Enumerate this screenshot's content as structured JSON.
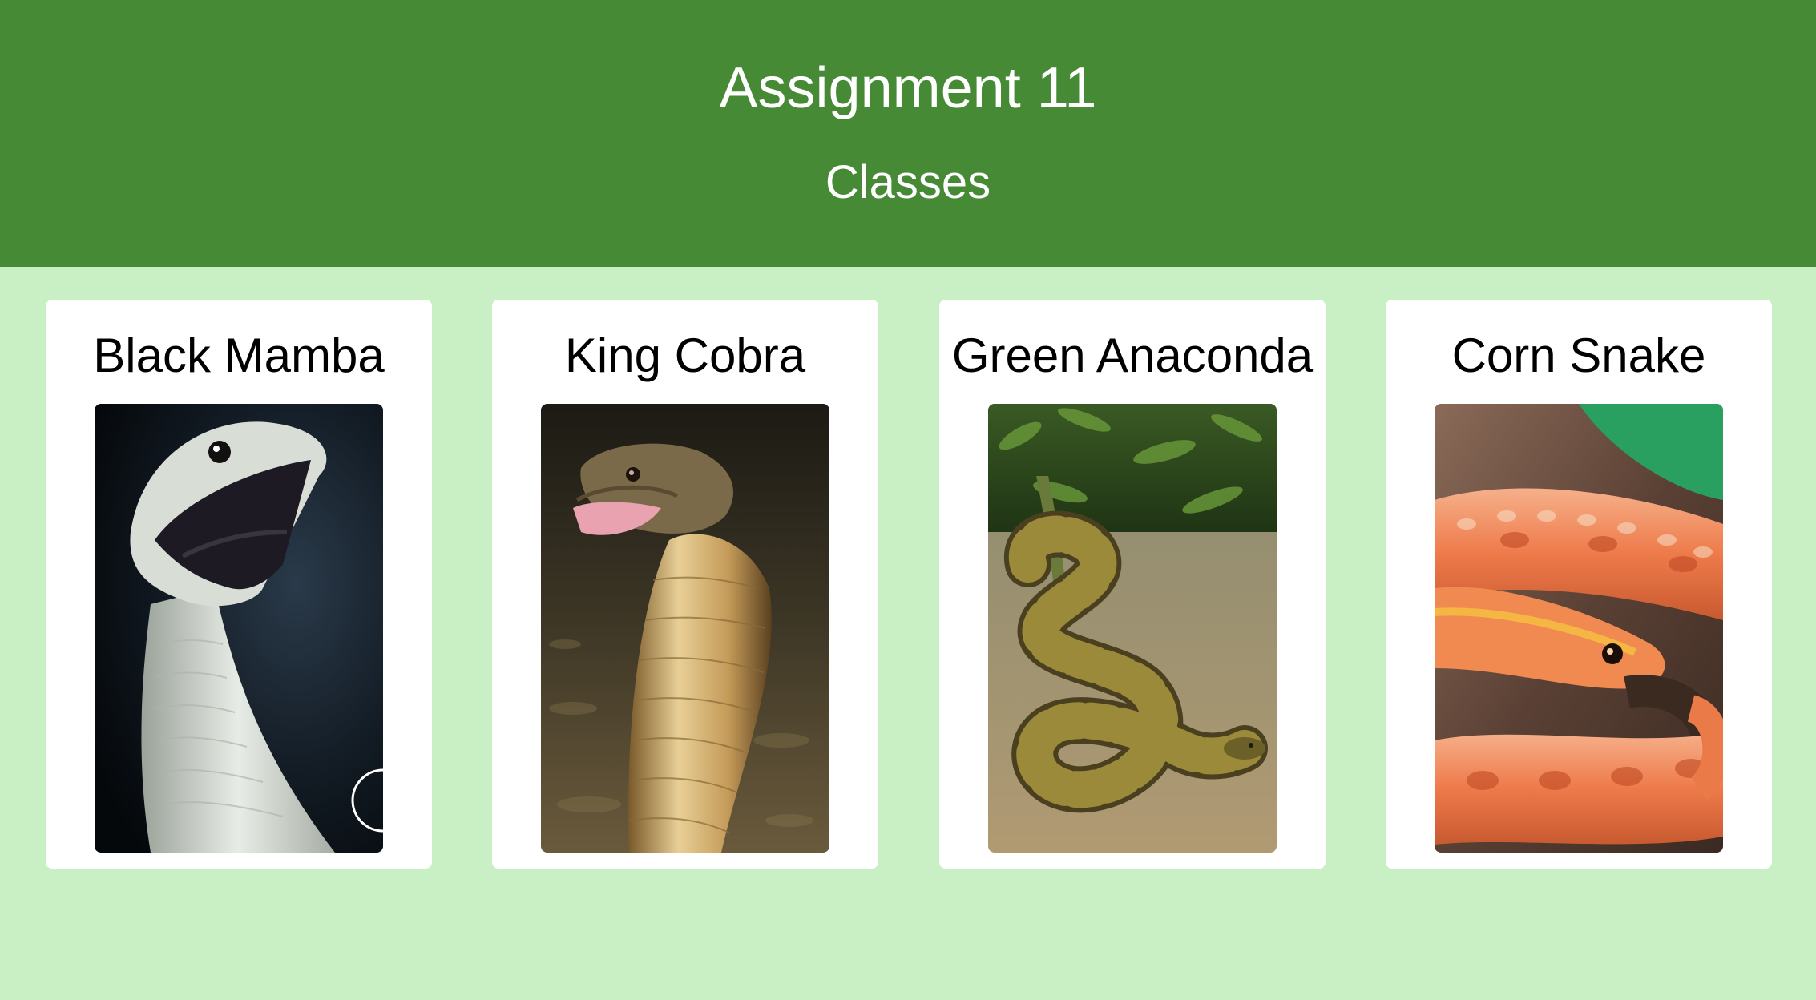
{
  "header": {
    "title": "Assignment 11",
    "subtitle": "Classes"
  },
  "cards": [
    {
      "name": "Black Mamba",
      "image": "black-mamba-photo"
    },
    {
      "name": "King Cobra",
      "image": "king-cobra-photo"
    },
    {
      "name": "Green Anaconda",
      "image": "green-anaconda-photo"
    },
    {
      "name": "Corn Snake",
      "image": "corn-snake-photo"
    }
  ],
  "colors": {
    "header_bg": "#468a35",
    "page_bg": "#c9efc4",
    "card_bg": "#ffffff"
  }
}
